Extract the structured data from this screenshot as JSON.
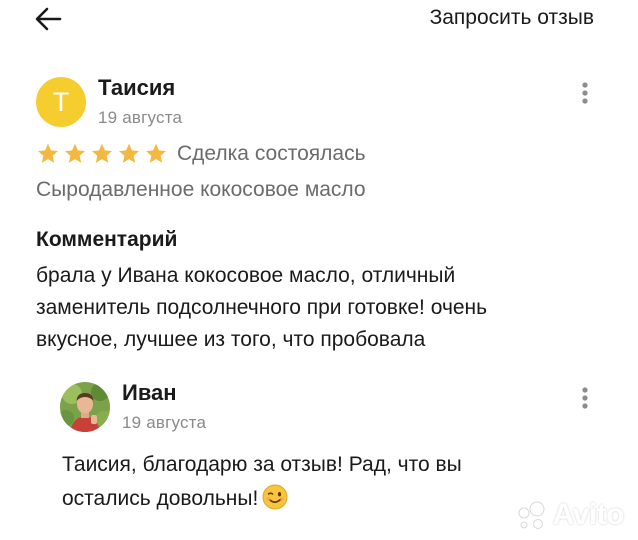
{
  "header": {
    "back_icon": "arrow-left-icon",
    "request_review_label": "Запросить отзыв"
  },
  "review": {
    "avatar_letter": "Т",
    "avatar_color": "#f5cd2f",
    "author_name": "Таисия",
    "date": "19 августа",
    "rating": 5,
    "rating_max": 5,
    "star_color": "#f4b73f",
    "deal_status": "Сделка состоялась",
    "product": "Сыродавленное кокосовое масло",
    "comment_heading": "Комментарий",
    "comment_lines": [
      "брала у Ивана кокосовое масло, отличный",
      "заменитель подсолнечного при готовке! очень",
      "вкусное, лучшее из того, что пробовала"
    ],
    "menu_icon": "more-vertical-icon"
  },
  "reply": {
    "author_name": "Иван",
    "date": "19 августа",
    "text_lines": [
      "Таисия, благодарю за отзыв! Рад, что вы",
      "остались довольны!"
    ],
    "emoji": "winking-face-icon",
    "menu_icon": "more-vertical-icon"
  },
  "watermark": {
    "text": "Avito"
  }
}
